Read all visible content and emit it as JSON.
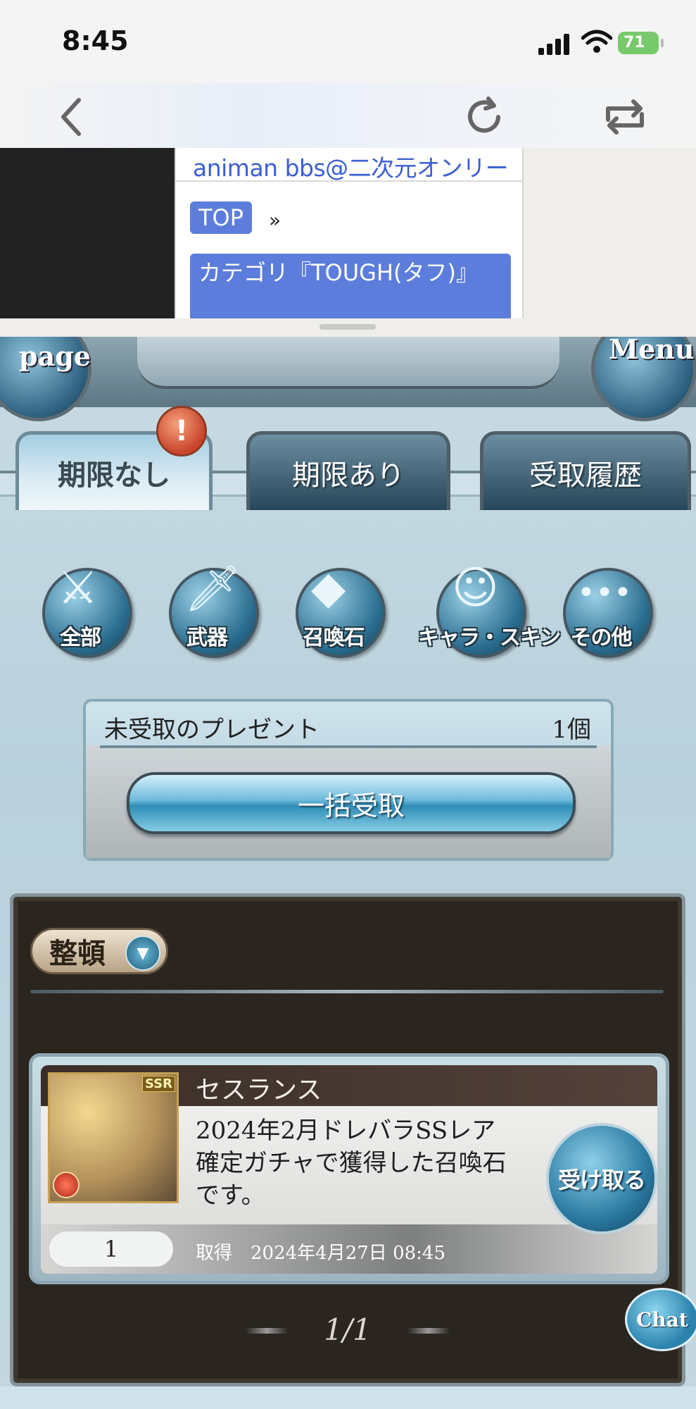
{
  "status_bar": {
    "time": "8:45",
    "battery": "71"
  },
  "browser": {
    "back_icon": "chevron-left-icon",
    "reload_icon": "reload-icon",
    "share_icon": "repost-icon"
  },
  "web_preview": {
    "site_title": "animan bbs@二次元オンリー",
    "breadcrumb_top": "TOP",
    "breadcrumb_separator": "»",
    "breadcrumb_category": "カテゴリ『TOUGH(タフ)』"
  },
  "game": {
    "mypage_label": "page",
    "menu_label": "Menu",
    "tabs": [
      {
        "label": "期限なし",
        "active": true
      },
      {
        "label": "期限あり",
        "active": false
      },
      {
        "label": "受取履歴",
        "active": false
      }
    ],
    "tab_badge": "!",
    "filters": [
      {
        "label": "全部",
        "icon": "all-items-icon"
      },
      {
        "label": "武器",
        "icon": "sword-icon"
      },
      {
        "label": "召喚石",
        "icon": "crystal-icon"
      },
      {
        "label": "キャラ・スキン",
        "icon": "character-icon"
      },
      {
        "label": "その他",
        "icon": "more-icon"
      }
    ],
    "present": {
      "label": "未受取のプレゼント",
      "count": "1個",
      "claim_all": "一括受取"
    },
    "sort_label": "整頓",
    "items": [
      {
        "name": "セスランス",
        "rarity": "SSR",
        "description": "2024年2月ドレバラSSレア確定ガチャで獲得した召喚石です。",
        "quantity": "1",
        "acquired_label": "取得",
        "acquired_date": "2024年4月27日 08:45",
        "receive_label": "受け取る"
      }
    ],
    "pager": "1/1",
    "chat_label": "Chat"
  },
  "colors": {
    "link_blue": "#3d5ed4",
    "crumb_bg": "#5c7ddb",
    "panel_dark": "#2a251f"
  }
}
